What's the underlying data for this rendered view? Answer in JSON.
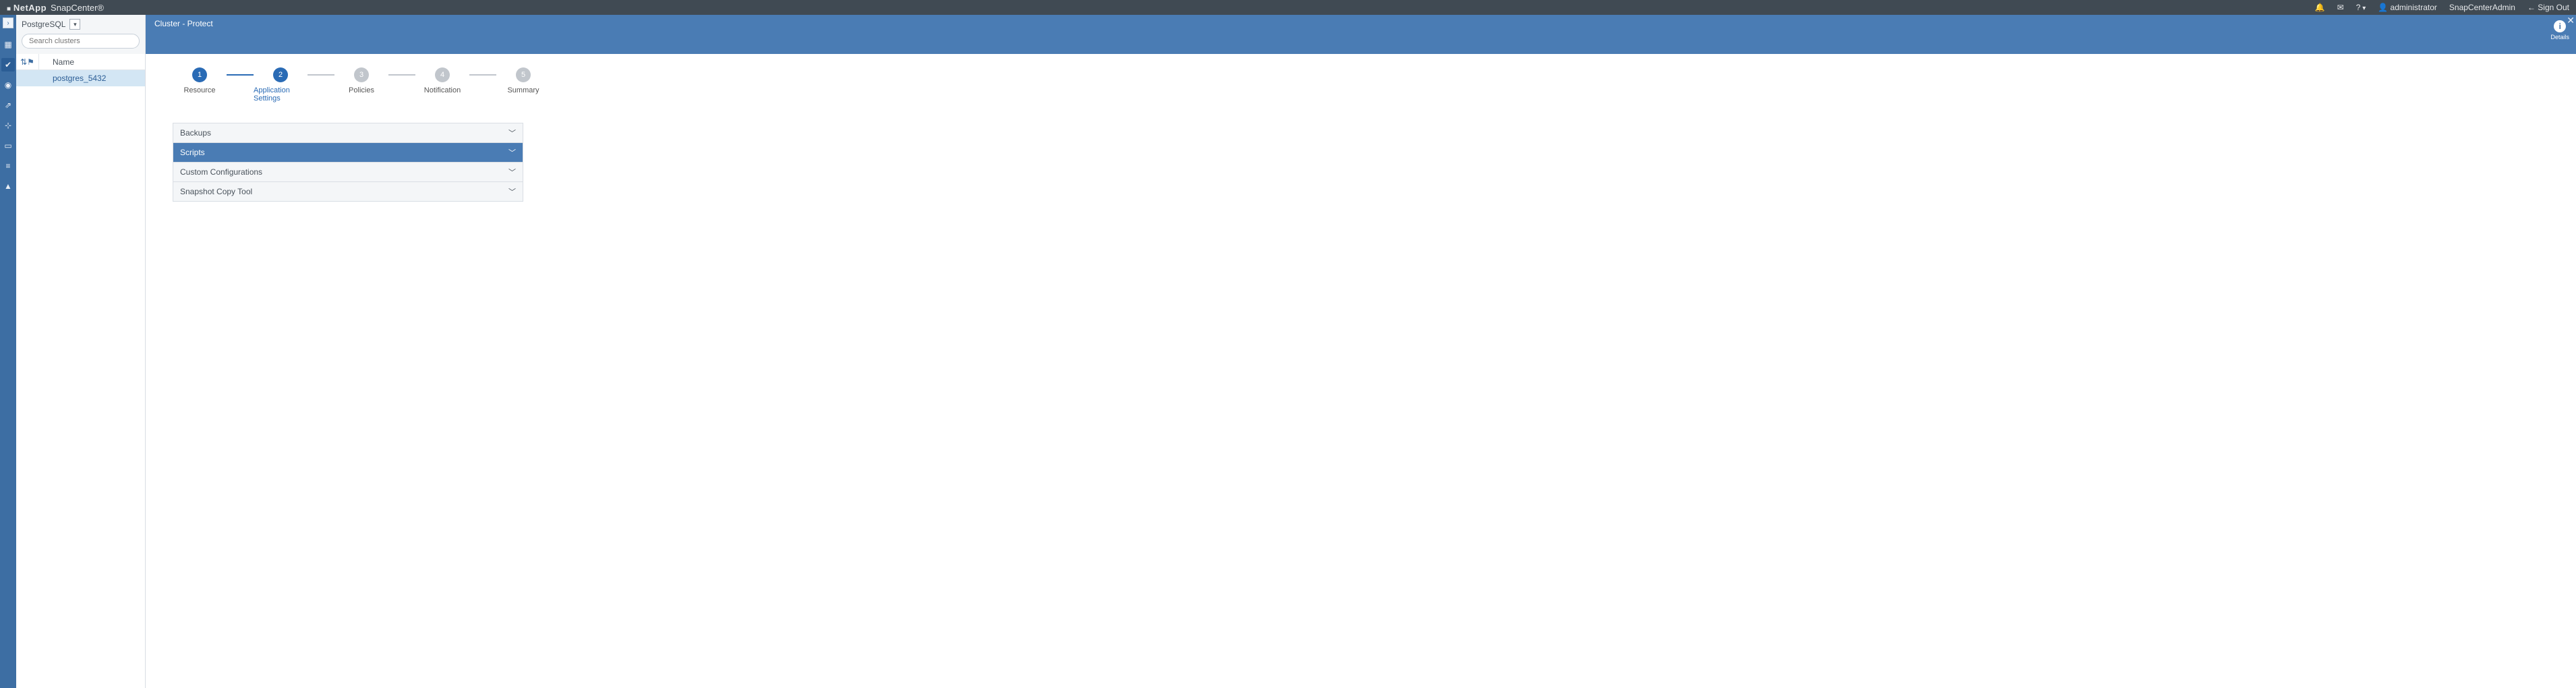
{
  "topbar": {
    "brand_vendor": "NetApp",
    "brand_product": "SnapCenter®",
    "user": "administrator",
    "role": "SnapCenterAdmin",
    "signout": "Sign Out"
  },
  "subheader": {
    "plugin": "PostgreSQL",
    "search_placeholder": "Search clusters",
    "breadcrumb": "Cluster - Protect",
    "details_label": "Details"
  },
  "resources": {
    "column_name": "Name",
    "rows": [
      {
        "name": "postgres_5432"
      }
    ]
  },
  "wizard": {
    "steps": [
      {
        "num": "1",
        "label": "Resource",
        "state": "done"
      },
      {
        "num": "2",
        "label": "Application Settings",
        "state": "current"
      },
      {
        "num": "3",
        "label": "Policies",
        "state": "todo"
      },
      {
        "num": "4",
        "label": "Notification",
        "state": "todo"
      },
      {
        "num": "5",
        "label": "Summary",
        "state": "todo"
      }
    ],
    "accordion": [
      {
        "label": "Backups",
        "active": false
      },
      {
        "label": "Scripts",
        "active": true
      },
      {
        "label": "Custom Configurations",
        "active": false
      },
      {
        "label": "Snapshot Copy Tool",
        "active": false
      }
    ]
  },
  "icons": {
    "bell": "🔔",
    "mail": "✉",
    "help": "?",
    "grid": "▦",
    "shield": "✔",
    "globe": "◉",
    "chart": "⇗",
    "nodes": "⊹",
    "server": "▭",
    "sliders": "≡",
    "alert": "▲",
    "expand": "›",
    "sort": "⇅",
    "flag": "⚑",
    "chev": "﹀",
    "caret": "▾"
  }
}
